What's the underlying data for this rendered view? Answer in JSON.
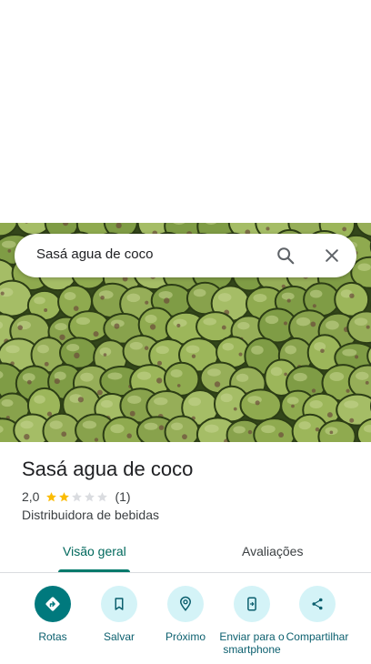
{
  "search": {
    "query": "Sasá agua de coco"
  },
  "place": {
    "name": "Sasá agua de coco",
    "rating": "2,0",
    "rating_value": 2,
    "rating_max": 5,
    "review_count": "(1)",
    "category": "Distribuidora de bebidas"
  },
  "tabs": [
    {
      "label": "Visão geral",
      "active": true
    },
    {
      "label": "Avaliações",
      "active": false
    }
  ],
  "actions": [
    {
      "label": "Rotas",
      "icon": "directions-icon",
      "primary": true
    },
    {
      "label": "Salvar",
      "icon": "bookmark-icon",
      "primary": false
    },
    {
      "label": "Próximo",
      "icon": "nearby-icon",
      "primary": false
    },
    {
      "label": "Enviar para o smartphone",
      "icon": "send-to-phone-icon",
      "primary": false
    },
    {
      "label": "Compartilhar",
      "icon": "share-icon",
      "primary": false
    }
  ],
  "colors": {
    "accent": "#00796b",
    "star_filled": "#fbbc04",
    "star_empty": "#dadce0",
    "action_circle": "#d4f3f7",
    "action_primary": "#00797d"
  }
}
